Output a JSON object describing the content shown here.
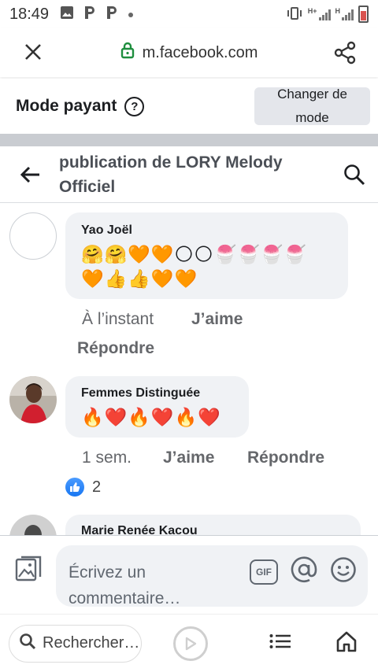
{
  "status_bar": {
    "time": "18:49",
    "left_icons": [
      "image-icon",
      "p-app-icon",
      "p-app-icon",
      "dot-icon"
    ],
    "right_icons": [
      "vibrate-icon",
      "signal-icon",
      "signal-icon",
      "battery-icon"
    ],
    "net_label_1": "H+",
    "net_label_2": "H"
  },
  "browser": {
    "url": "m.facebook.com",
    "close_icon": "close-icon",
    "lock_icon": "lock-icon",
    "share_icon": "share-icon"
  },
  "mode": {
    "title": "Mode payant",
    "help_label": "?",
    "change_button": "Changer de\nmode"
  },
  "post_header": {
    "title": "publication de LORY Melody Officiel"
  },
  "comments": [
    {
      "author": "Yao Joël",
      "text_line1": "🤗🤗🧡🧡🌕🌕🍧🍧🍧🍧",
      "text_line2": "🧡👍👍🧡🧡",
      "time": "À l’instant",
      "like_label": "J’aime",
      "reply_label": "Répondre"
    },
    {
      "author": "Femmes Distinguée",
      "text_line1": "🔥❤️🔥❤️🔥❤️",
      "time": "1 sem.",
      "like_label": "J’aime",
      "reply_label": "Répondre",
      "reaction_count": "2"
    },
    {
      "author": "Marie Renée Kacou"
    }
  ],
  "composer": {
    "placeholder": "Écrivez un commentaire…",
    "gif_label": "GIF"
  },
  "bottom_bar": {
    "search_label": "Rechercher…"
  },
  "colors": {
    "accent_blue": "#1877f2",
    "bubble_gray": "#f0f2f5",
    "lock_green": "#1e8e3e"
  }
}
